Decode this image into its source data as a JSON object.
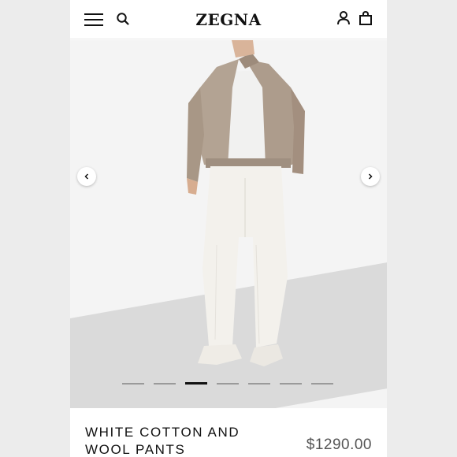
{
  "header": {
    "brand": "ZEGNA",
    "icons": [
      "menu-icon",
      "search-icon",
      "account-icon",
      "shopping-bag-icon"
    ]
  },
  "gallery": {
    "slide_count": 7,
    "active_slide": 3,
    "prev_icon": "chevron-left-icon",
    "next_icon": "chevron-right-icon"
  },
  "product": {
    "title": "WHITE COTTON AND WOOL PANTS",
    "price": "$1290.00"
  },
  "colors": {
    "background": "#ffffff",
    "text": "#111111",
    "price": "#555555",
    "jacket": "#b3a393",
    "pants": "#f3f1ec"
  }
}
